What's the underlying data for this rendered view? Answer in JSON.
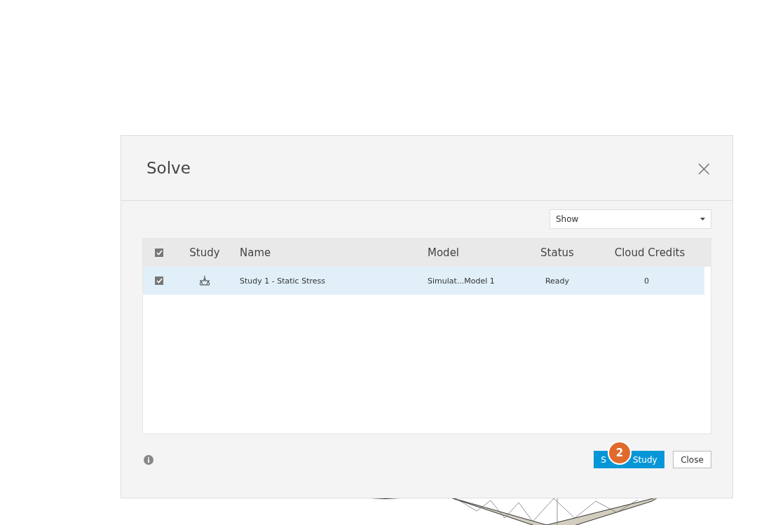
{
  "dialog": {
    "title": "Solve",
    "close": "×"
  },
  "filter": {
    "value": "Show"
  },
  "table": {
    "select_all": {
      "checked": true
    },
    "columns": [
      "Study",
      "Name",
      "Model",
      "Status",
      "Cloud Credits"
    ],
    "rows": [
      {
        "checked": true,
        "selected": true,
        "name": "Study 1 - Static Stress",
        "model": "Simulat...Model 1",
        "status": "Ready",
        "credits": "0"
      }
    ]
  },
  "footer": {
    "primary_button": {
      "label_start": "S",
      "label_end": "Study"
    },
    "step_badge": "2",
    "close_button": "Close"
  }
}
